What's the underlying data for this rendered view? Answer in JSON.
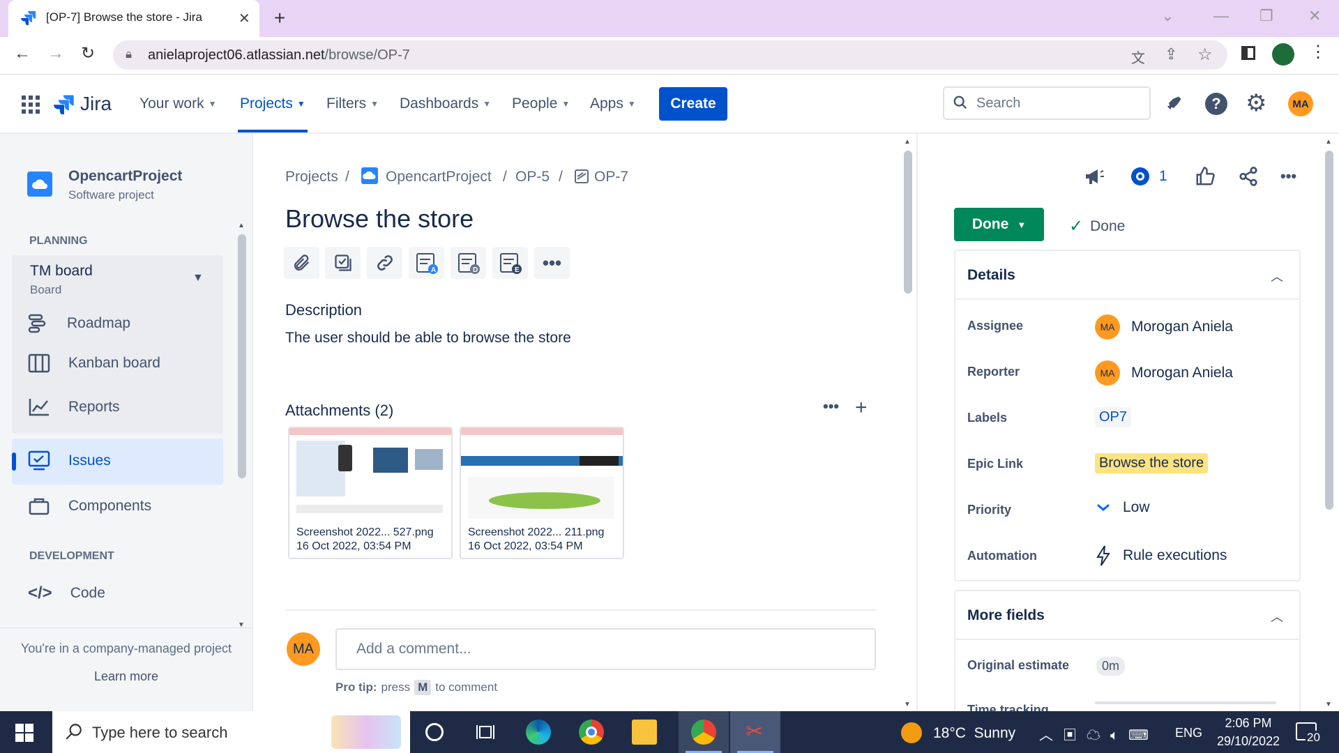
{
  "browser": {
    "tab_title": "[OP-7] Browse the store - Jira",
    "url_host": "anielaproject06.atlassian.net",
    "url_path": "/browse/OP-7"
  },
  "nav": {
    "logo": "Jira",
    "items": [
      "Your work",
      "Projects",
      "Filters",
      "Dashboards",
      "People",
      "Apps"
    ],
    "create_label": "Create",
    "search_placeholder": "Search",
    "user_initials": "MA"
  },
  "sidebar": {
    "project_name": "OpencartProject",
    "project_type": "Software project",
    "planning_label": "PLANNING",
    "board_name": "TM board",
    "board_sub": "Board",
    "planning_items": [
      "Roadmap",
      "Kanban board",
      "Reports"
    ],
    "issues_label": "Issues",
    "components_label": "Components",
    "development_label": "DEVELOPMENT",
    "code_label": "Code",
    "footer_text": "You're in a company-managed project",
    "learn_more": "Learn more"
  },
  "issue": {
    "breadcrumb": [
      "Projects",
      "OpencartProject",
      "OP-5",
      "OP-7"
    ],
    "title": "Browse the store",
    "description_heading": "Description",
    "description": "The user should be able to browse the store",
    "attachments_heading": "Attachments (2)",
    "attachments": [
      {
        "name": "Screenshot 2022... 527.png",
        "date": "16 Oct 2022, 03:54 PM"
      },
      {
        "name": "Screenshot 2022... 211.png",
        "date": "16 Oct 2022, 03:54 PM"
      }
    ],
    "comment_placeholder": "Add a comment...",
    "protip_prefix": "Pro tip:",
    "protip_press": "press",
    "protip_key": "M",
    "protip_suffix": "to comment"
  },
  "right": {
    "watch_count": "1",
    "status_label": "Done",
    "resolution": "Done",
    "details_heading": "Details",
    "fields": {
      "assignee_label": "Assignee",
      "assignee": "Morogan Aniela",
      "reporter_label": "Reporter",
      "reporter": "Morogan Aniela",
      "labels_label": "Labels",
      "labels": "OP7",
      "epic_label": "Epic Link",
      "epic": "Browse the store",
      "priority_label": "Priority",
      "priority": "Low",
      "automation_label": "Automation",
      "automation": "Rule executions"
    },
    "more_fields_heading": "More fields",
    "orig_estimate_label": "Original estimate",
    "orig_estimate": "0m",
    "time_tracking_label": "Time tracking"
  },
  "taskbar": {
    "search_placeholder": "Type here to search",
    "weather": "18°C  Sunny",
    "lang": "ENG",
    "time": "2:06 PM",
    "date": "29/10/2022",
    "notif_count": "20"
  },
  "colors": {
    "jira_blue": "#0052CC",
    "done_green": "#00875A",
    "avatar_orange": "#FF991F",
    "epic_yellow": "#FFE380"
  }
}
